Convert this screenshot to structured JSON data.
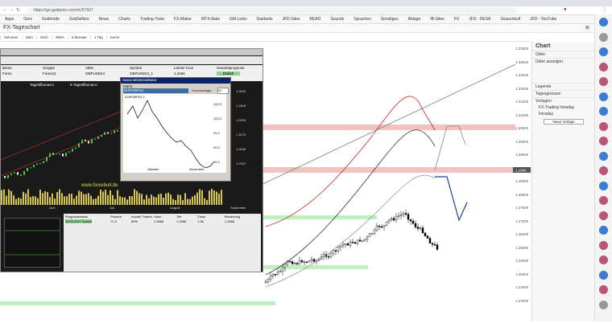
{
  "browser": {
    "url": "https://go.guidants.com/#c/57937",
    "bookmarks": [
      "Apps",
      "Gmx",
      "Godmode",
      "GodSellers",
      "News",
      "Charts",
      "Trading-Tools",
      "FX-Maker",
      "MT4-Stats",
      "GM-Links",
      "Guidants",
      "JFD-Sites",
      "READ",
      "Sounds",
      "Sprachen",
      "Sonstiges",
      "Ablage",
      "IB-Sites",
      "FX",
      "JFD - DESA",
      "Seasonbull",
      "JFD - YouTube"
    ]
  },
  "app": {
    "title": "FX-Tageschart",
    "toolbar": [
      "Volumen",
      "SMA",
      "EMA",
      "WMA",
      "8 Monate",
      "1 Tag",
      "Kerze"
    ]
  },
  "price_axis": [
    "1.33500",
    "1.33000",
    "1.32500",
    "1.32000",
    "1.31500",
    "1.31000",
    "1.30500",
    "1.30000",
    "1.29500",
    "1.29000",
    "1.28500",
    "1.28000",
    "1.27500",
    "1.27000",
    "1.26500",
    "1.26000",
    "1.25500",
    "1.25000",
    "1.24500",
    "1.24000"
  ],
  "current_price": "1.2886",
  "panel": {
    "title": "Chart",
    "sections": [
      "Gitter",
      "Gitter anzeigen",
      "Legende",
      "Tagesgrenzen",
      "Vorlagen"
    ],
    "items": [
      "FX-Trading Intraday",
      "Intraday"
    ],
    "button": "Neue Vorlage"
  },
  "overlay": {
    "headers": [
      "Börse",
      "Gruppe",
      "Aktie",
      "Symbol",
      "Letzter Kurs",
      "Gesamtprognose"
    ],
    "values": [
      "Forex",
      "Forex24",
      "GBPUSD24",
      "GBPUSD24_1",
      "1,3466",
      "Bullish"
    ],
    "tab1": "Tagesfibonacci",
    "tab2": "5-Tagesfibonacci",
    "inner_title": "Saisonalitätsindikator",
    "inner_label": "Markt",
    "inner_select": "EURGBP24",
    "inner_scale_label": "Vorschautage",
    "inner_scale_value": "40",
    "inner_plot_label": "EURGBP24 1",
    "inner_months": [
      "Oktober",
      "November"
    ],
    "inner_y": [
      "100.5",
      "100.2",
      "99.9",
      "99.6",
      "99.3"
    ],
    "watermark": "www.forexbull.de",
    "left_y": [
      "1.3542",
      "1.3418",
      "1.3294",
      "1.3170",
      "1.3046",
      "1.2922"
    ],
    "months": [
      "Juni",
      "Juli",
      "August",
      "September"
    ],
    "table_headers": [
      "Prognosedatum",
      "Prozent",
      "Anzahl Trades",
      "Hoch",
      "Tief",
      "Close",
      "Bewertung"
    ],
    "table_row": [
      "10.09.2017 Bullish",
      "71.3",
      "65%",
      "1.3666",
      "1.3466",
      "1.36",
      "1.3466"
    ]
  }
}
